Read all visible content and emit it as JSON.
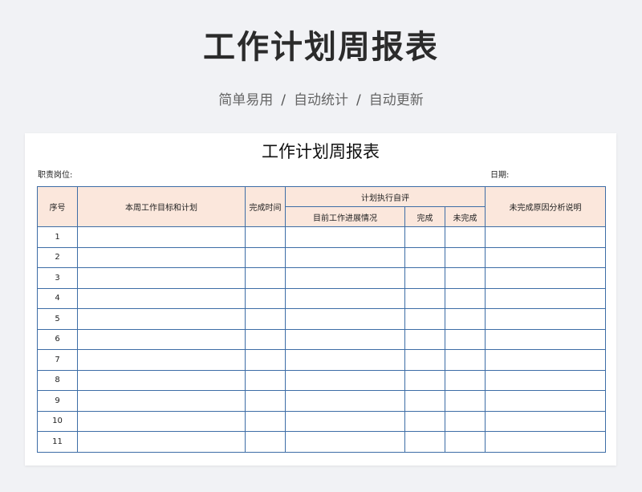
{
  "hero": {
    "title": "工作计划周报表",
    "tags": [
      "简单易用",
      "自动统计",
      "自动更新"
    ],
    "separator": "/"
  },
  "sheet": {
    "title": "工作计划周报表",
    "position_label": "职责岗位:",
    "date_label": "日期:",
    "headers": {
      "index": "序号",
      "plan": "本周工作目标和计划",
      "deadline": "完成时间",
      "self_eval": "计划执行自评",
      "progress": "目前工作进展情况",
      "done": "完成",
      "not_done": "未完成",
      "reason": "未完成原因分析说明"
    },
    "rows": [
      "1",
      "2",
      "3",
      "4",
      "5",
      "6",
      "7",
      "8",
      "9",
      "10",
      "11"
    ]
  }
}
